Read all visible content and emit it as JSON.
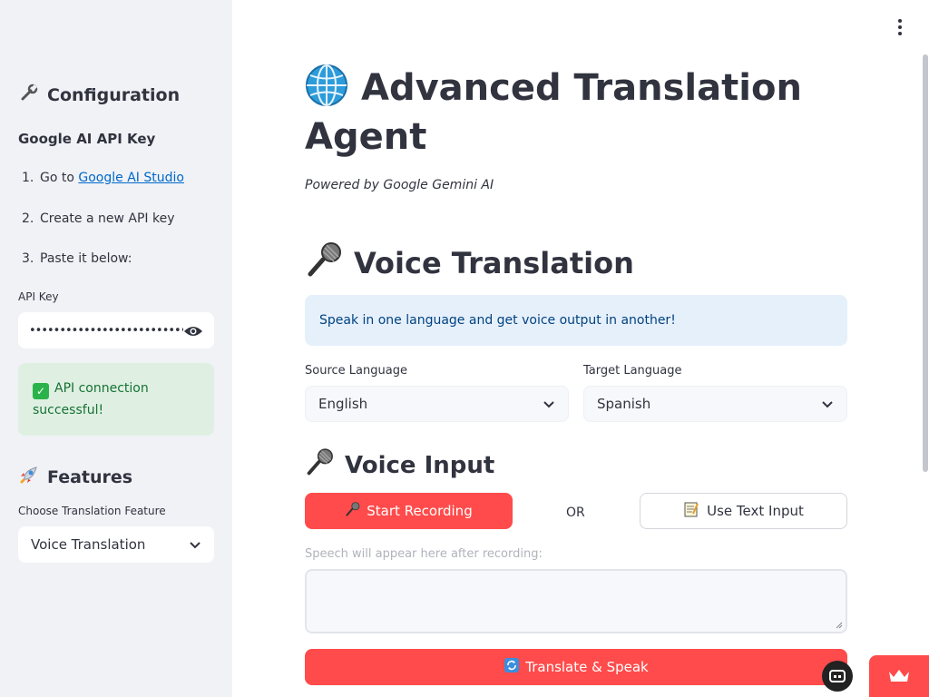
{
  "sidebar": {
    "config_title": "Configuration",
    "api_section_title": "Google AI API Key",
    "steps": [
      {
        "num": "1.",
        "text_before": "Go to ",
        "link": "Google AI Studio"
      },
      {
        "num": "2.",
        "text": "Create a new API key"
      },
      {
        "num": "3.",
        "text": "Paste it below:"
      }
    ],
    "api_key_label": "API Key",
    "api_key_value": "••••••••••••••••••••••••••••••••",
    "success_message": "API connection successful!",
    "features_title": "Features",
    "feature_select_label": "Choose Translation Feature",
    "feature_select_value": "Voice Translation"
  },
  "main": {
    "title": "Advanced Translation Agent",
    "subtitle": "Powered by Google Gemini AI",
    "section_title": "Voice Translation",
    "info_text": "Speak in one language and get voice output in another!",
    "source_label": "Source Language",
    "source_value": "English",
    "target_label": "Target Language",
    "target_value": "Spanish",
    "voice_input_title": "Voice Input",
    "start_recording_label": "Start Recording",
    "or_text": "OR",
    "use_text_label": "Use Text Input",
    "speech_hint": "Speech will appear here after recording:",
    "translate_label": "Translate & Speak"
  },
  "colors": {
    "primary": "#ff4b4b",
    "sidebar_bg": "#f0f2f6",
    "info_bg": "#e6f0fb",
    "success_bg": "#dff0e3",
    "link": "#0068c9"
  },
  "icons": {
    "config": "wrench-icon",
    "features": "rocket-icon",
    "title": "globe-icon",
    "voice": "microphone-icon",
    "text_input": "memo-icon",
    "translate": "refresh-icon"
  }
}
